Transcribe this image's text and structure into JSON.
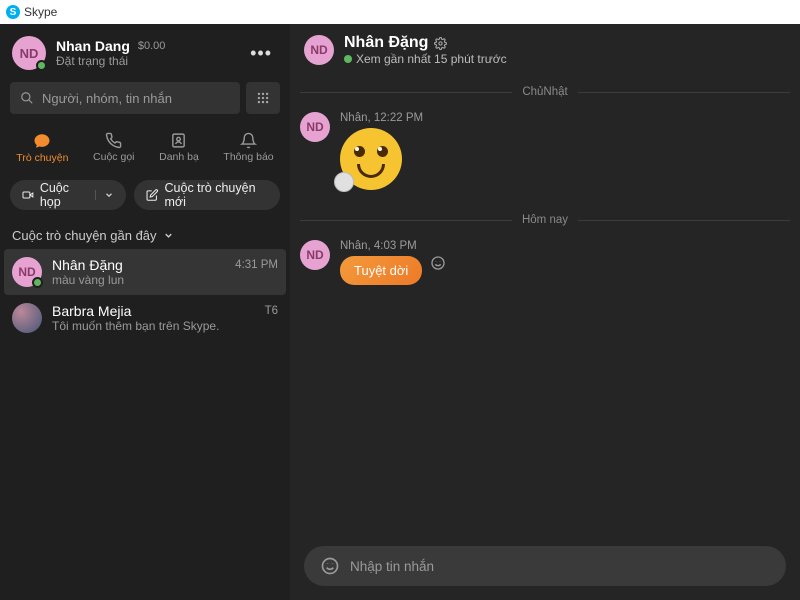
{
  "window": {
    "title": "Skype"
  },
  "self": {
    "initials": "ND",
    "name": "Nhan Dang",
    "balance": "$0.00",
    "status": "Đặt trạng thái"
  },
  "search": {
    "placeholder": "Người, nhóm, tin nhắn"
  },
  "tabs": {
    "chat": "Trò chuyện",
    "calls": "Cuộc gọi",
    "contacts": "Danh bạ",
    "notifications": "Thông báo"
  },
  "actions": {
    "meeting": "Cuộc họp",
    "new_chat": "Cuộc trò chuyện mới"
  },
  "recent_header": "Cuộc trò chuyện gần đây",
  "conversations": [
    {
      "initials": "ND",
      "name": "Nhân Đặng",
      "preview": "màu vàng lun",
      "time": "4:31 PM"
    },
    {
      "initials": "",
      "name": "Barbra Mejia",
      "preview": "Tôi muốn thêm bạn trên Skype.",
      "time": "T6"
    }
  ],
  "chat": {
    "initials": "ND",
    "title": "Nhân Đặng",
    "subtitle": "Xem gần nhất 15 phút trước"
  },
  "messages": {
    "day1_label": "ChủNhật",
    "m1_meta": "Nhân, 12:22 PM",
    "day2_label": "Hôm nay",
    "m2_meta": "Nhân, 4:03 PM",
    "m2_text": "Tuyệt dời"
  },
  "compose": {
    "placeholder": "Nhập tin nhắn"
  }
}
